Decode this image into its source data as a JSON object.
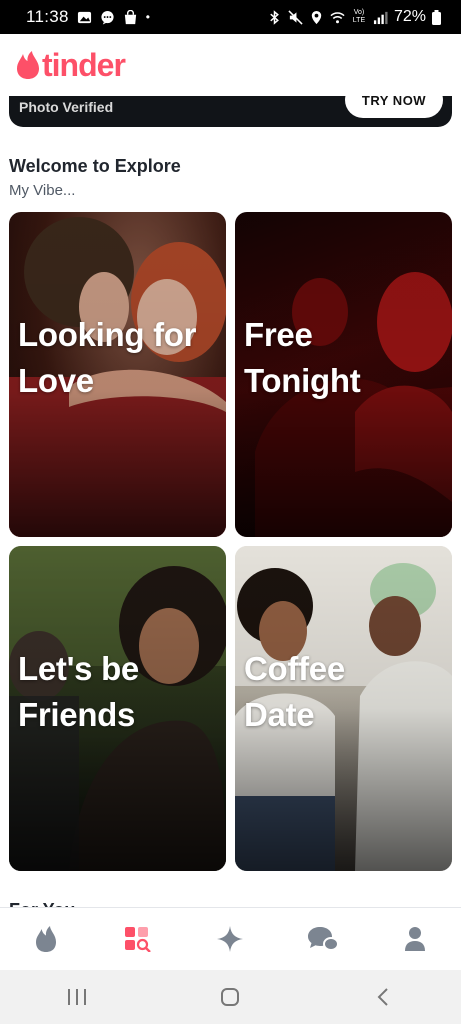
{
  "status": {
    "time": "11:38",
    "dot": "•",
    "network": "Vo) LTE",
    "battery": "72%"
  },
  "header": {
    "logo_text": "tinder",
    "brand_color": "#fd5068"
  },
  "banner": {
    "label": "Photo Verified",
    "button": "TRY NOW"
  },
  "explore": {
    "title": "Welcome to Explore",
    "subtitle": "My Vibe...",
    "cards": [
      {
        "title": "Looking for\nLove"
      },
      {
        "title": "Free\nTonight"
      },
      {
        "title": "Let's be\nFriends"
      },
      {
        "title": "Coffee\nDate"
      }
    ],
    "next_section": "For You"
  },
  "nav": {
    "items": [
      "flame-icon",
      "explore-icon",
      "sparkle-icon",
      "chat-icon",
      "profile-icon"
    ],
    "active": "explore-icon",
    "inactive_color": "#7c8591"
  },
  "system_nav": [
    "recent-apps-icon",
    "home-icon",
    "back-icon"
  ]
}
